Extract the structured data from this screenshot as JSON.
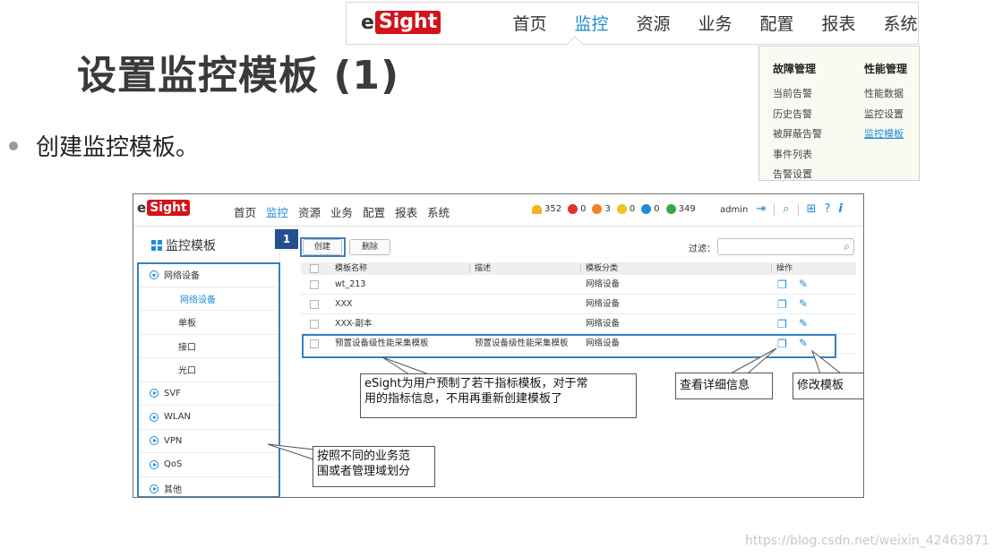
{
  "slide": {
    "title": "设置监控模板 (1)",
    "bullet": "创建监控模板。"
  },
  "topnav": {
    "logo_e": "e",
    "logo_sight": "Sight",
    "items": [
      "首页",
      "监控",
      "资源",
      "业务",
      "配置",
      "报表",
      "系统"
    ],
    "active_index": 1
  },
  "dropdown": {
    "col1": {
      "header": "故障管理",
      "items": [
        "当前告警",
        "历史告警",
        "被屏蔽告警",
        "事件列表",
        "告警设置"
      ]
    },
    "col2": {
      "header": "性能管理",
      "items": [
        "性能数据",
        "监控设置",
        "监控模板"
      ],
      "active_index": 2
    }
  },
  "screenshot": {
    "logo_e": "e",
    "logo_sight": "Sight",
    "nav": [
      "首页",
      "监控",
      "资源",
      "业务",
      "配置",
      "报表",
      "系统"
    ],
    "nav_active_index": 1,
    "alarms": [
      {
        "icon": "bell-icon",
        "color": "#f2b41f",
        "count": "352"
      },
      {
        "icon": "critical-icon",
        "color": "#e0352b",
        "count": "0"
      },
      {
        "icon": "major-icon",
        "color": "#f0822a",
        "count": "3"
      },
      {
        "icon": "minor-icon",
        "color": "#f2c21f",
        "count": "0"
      },
      {
        "icon": "info-icon",
        "color": "#1e8cd6",
        "count": "0"
      },
      {
        "icon": "check-icon",
        "color": "#3aa64a",
        "count": "349"
      }
    ],
    "user": "admin",
    "sidebar": {
      "title": "监控模板",
      "groups": [
        {
          "label": "网络设备",
          "expanded": true,
          "children": [
            "网络设备",
            "单板",
            "接口",
            "光口"
          ],
          "selected_child": 0
        },
        {
          "label": "SVF"
        },
        {
          "label": "WLAN"
        },
        {
          "label": "VPN"
        },
        {
          "label": "QoS"
        },
        {
          "label": "其他"
        }
      ]
    },
    "toolbar": {
      "create": "创建",
      "delete": "删除",
      "filter_label": "过滤：",
      "filter_value": ""
    },
    "table": {
      "headers": [
        "模板名称",
        "描述",
        "模板分类",
        "操作"
      ],
      "rows": [
        {
          "name": "wt_213",
          "desc": "",
          "category": "网络设备"
        },
        {
          "name": "XXX",
          "desc": "",
          "category": "网络设备"
        },
        {
          "name": "XXX-副本",
          "desc": "",
          "category": "网络设备"
        },
        {
          "name": "预置设备级性能采集模板",
          "desc": "预置设备级性能采集模板",
          "category": "网络设备"
        }
      ]
    },
    "annotations": {
      "step_badge": "1",
      "preset_note_line1": "eSight为用户预制了若干指标模板，对于常",
      "preset_note_line2": "用的指标信息，不用再重新创建模板了",
      "view_detail": "查看详细信息",
      "edit_template": "修改模板",
      "group_note_line1": "按照不同的业务范",
      "group_note_line2": "围或者管理域划分"
    }
  },
  "watermark": "https://blog.csdn.net/weixin_42463871"
}
